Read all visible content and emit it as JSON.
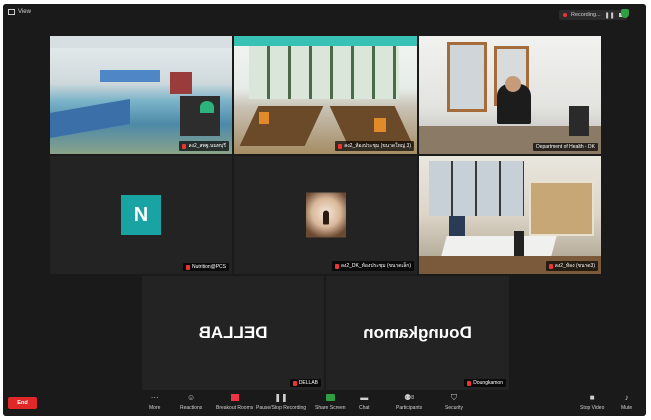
{
  "topbar": {
    "view_label": "View",
    "recording_label": "Recording..."
  },
  "tiles": [
    {
      "name": "ลง2_สพฐ.นนทบุรี"
    },
    {
      "name": "ลง2_ห้องประชุม (ขนาดใหญ่ 3)"
    },
    {
      "name": "Department of Health - DK"
    },
    {
      "name": "Nutrition@PCS"
    },
    {
      "name": "ลง2_DK_ห้องประชุม (ขนาดเล็ก)"
    },
    {
      "name": "ลง2_ห้อง (ขนาด3)"
    },
    {
      "name": "DELLAB",
      "big_text": "DELLAB"
    },
    {
      "name": "Doungkamon",
      "big_text": "Doungkamon"
    }
  ],
  "avatars": {
    "nutrition_initial": "N"
  },
  "toolbar": {
    "end_label": "End",
    "items": [
      {
        "label": "More"
      },
      {
        "label": "Reactions"
      },
      {
        "label": "Breakout Rooms"
      },
      {
        "label": "Pause/Stop Recording"
      },
      {
        "label": "Share Screen"
      },
      {
        "label": "Chat"
      },
      {
        "label": "Participants"
      },
      {
        "label": "Security"
      },
      {
        "label": "Stop Video"
      },
      {
        "label": "Mute"
      }
    ],
    "participants_count": "8"
  },
  "colors": {
    "active_border": "#c9d34a",
    "end_button": "#e02828",
    "avatar_bg": "#19a3a3",
    "share_screen": "#2ea043"
  }
}
